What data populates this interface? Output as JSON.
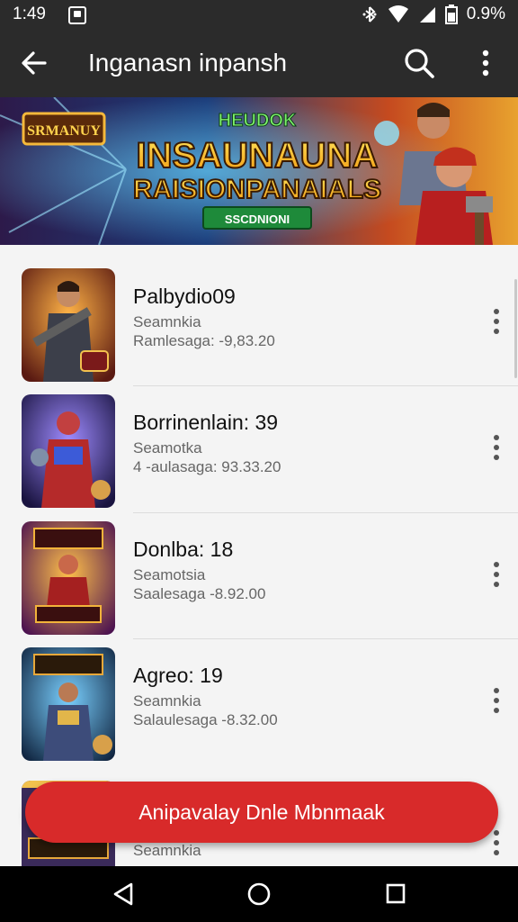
{
  "status_bar": {
    "time": "1:49",
    "battery": "0.9%"
  },
  "app_bar": {
    "title": "Inganasn inpansh"
  },
  "banner": {
    "top_badge": "SRMANUY",
    "headline_top": "HEUDOK",
    "headline_line1": "INSAUNAUNA",
    "headline_line2": "RAISIONPANAIALS",
    "ribbon": "SSCDNIONI"
  },
  "list": {
    "items": [
      {
        "name": "Palbydio09",
        "sub1": "Seamnkia",
        "sub2": "Ramlesaga: ‑9,83.20"
      },
      {
        "name": "Borrinenlain: 39",
        "sub1": "Seamotka",
        "sub2": "4 ‑aulasaga: 93.33.20"
      },
      {
        "name": "Donlba: 18",
        "sub1": "Seamotsia",
        "sub2": "Saalesaga ‑8.92.00"
      },
      {
        "name": "Agreo: 19",
        "sub1": "Seamnkia",
        "sub2": "Salaulesaga ‑8.32.00"
      },
      {
        "name": "",
        "sub1": "Seamnkia",
        "sub2": ""
      }
    ]
  },
  "fab": {
    "label": "Anipavalay Dnle Mbnmaak"
  },
  "colors": {
    "bar": "#2b2b2b",
    "accent": "#d82a2a",
    "background": "#f4f4f4"
  },
  "icons": [
    "back-arrow-icon",
    "search-icon",
    "more-vert-icon",
    "kebab-icon",
    "back-nav-icon",
    "home-nav-icon",
    "recents-nav-icon"
  ]
}
